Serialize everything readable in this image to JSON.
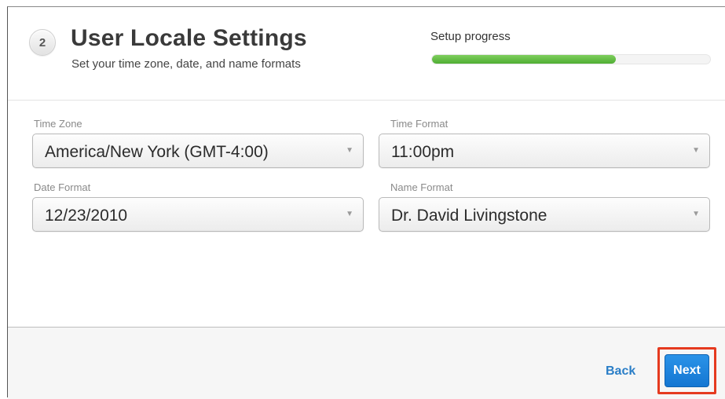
{
  "header": {
    "step_number": "2",
    "title": "User Locale Settings",
    "subtitle": "Set your time zone, date, and name formats",
    "progress_label": "Setup progress",
    "progress_fraction": 0.66,
    "progress_color": "#5cb83f"
  },
  "fields": {
    "time_zone": {
      "label": "Time Zone",
      "value": "America/New York (GMT-4:00)"
    },
    "time_format": {
      "label": "Time Format",
      "value": "11:00pm"
    },
    "date_format": {
      "label": "Date Format",
      "value": "12/23/2010"
    },
    "name_format": {
      "label": "Name Format",
      "value": "Dr. David Livingstone"
    }
  },
  "footer": {
    "back_label": "Back",
    "next_label": "Next",
    "accent_color": "#1a7fd9",
    "highlight_color": "#e53a1f"
  },
  "icons": {
    "caret": "▼"
  }
}
